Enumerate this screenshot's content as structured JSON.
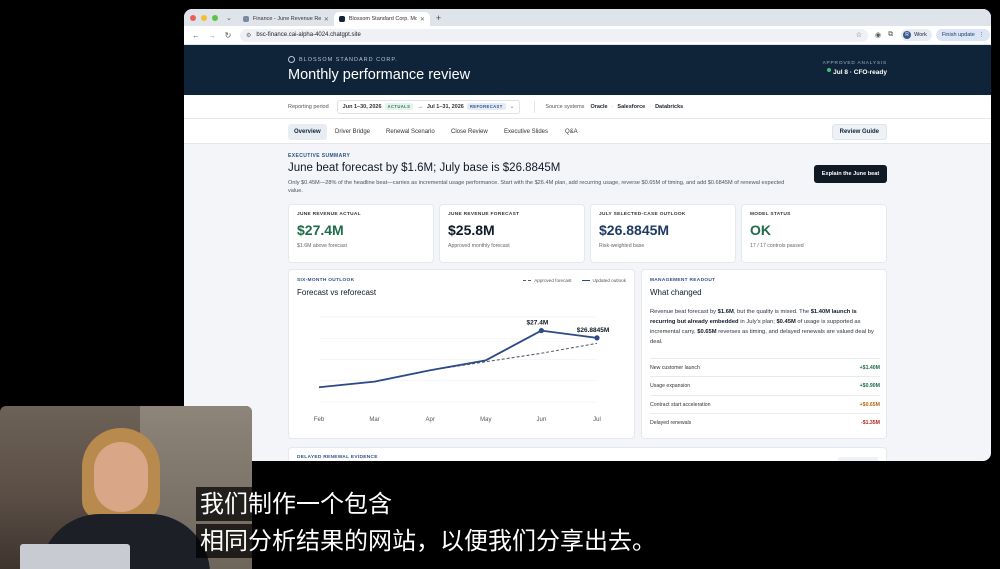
{
  "browser": {
    "tabs": [
      {
        "title": "Finance - June Revenue Rec",
        "active": false
      },
      {
        "title": "Blossom Standard Corp. Mo",
        "active": true
      }
    ],
    "url": "bsc-finance.cai-alpha-4024.chatgpt.site",
    "profile_label": "Work",
    "profile_initial": "R",
    "update_label": "Finish update"
  },
  "header": {
    "brand": "BLOSSOM STANDARD CORP.",
    "title": "Monthly performance review",
    "status_label": "APPROVED ANALYSIS",
    "status_value": "Jul 8 · CFO-ready"
  },
  "period": {
    "label": "Reporting period",
    "from": "Jun 1–30, 2026",
    "from_tag": "ACTUALS",
    "to": "Jul 1–31, 2026",
    "to_tag": "REFORECAST",
    "sources_label": "Source systems",
    "sources": [
      "Oracle",
      "Salesforce",
      "Databricks"
    ]
  },
  "nav": {
    "tabs": [
      "Overview",
      "Driver Bridge",
      "Renewal Scenario",
      "Close Review",
      "Executive Slides",
      "Q&A"
    ],
    "active": "Overview",
    "guide": "Review Guide"
  },
  "summary": {
    "kicker": "EXECUTIVE SUMMARY",
    "title": "June beat forecast by $1.6M; July base is $26.8845M",
    "body": "Only $0.45M—28% of the headline beat—carries as incremental usage performance. Start with the $26.4M plan, add recurring usage, reverse $0.65M of timing, and add $0.6845M of renewal expected value.",
    "button": "Explain the June beat"
  },
  "kpis": [
    {
      "label": "JUNE REVENUE ACTUAL",
      "value": "$27.4M",
      "sub": "$1.6M above forecast",
      "color": "#1f6b4a"
    },
    {
      "label": "JUNE REVENUE FORECAST",
      "value": "$25.8M",
      "sub": "Approved monthly forecast",
      "color": "#0f1a26"
    },
    {
      "label": "JULY SELECTED-CASE OUTLOOK",
      "value": "$26.8845M",
      "sub": "Risk-weighted base",
      "color": "#1f3b66"
    },
    {
      "label": "MODEL STATUS",
      "value": "OK",
      "sub": "17 / 17 controls passed",
      "color": "#1f6b4a"
    }
  ],
  "chart": {
    "kicker": "SIX-MONTH OUTLOOK",
    "title": "Forecast vs reforecast",
    "legend_approved": "Approved forecast",
    "legend_updated": "Updated outlook"
  },
  "chart_data": {
    "type": "line",
    "x": [
      "Feb",
      "Mar",
      "Apr",
      "May",
      "Jun",
      "Jul"
    ],
    "series": [
      {
        "name": "Approved forecast",
        "values": [
          23.4,
          23.8,
          24.6,
          25.2,
          25.8,
          26.5
        ],
        "style": "dashed",
        "color": "#55606e"
      },
      {
        "name": "Updated outlook",
        "values": [
          23.4,
          23.8,
          24.6,
          25.3,
          27.4,
          26.8845
        ],
        "style": "solid",
        "color": "#2b4a86"
      }
    ],
    "point_labels": [
      {
        "index": 4,
        "series": 1,
        "text": "$27.4M"
      },
      {
        "index": 5,
        "series": 1,
        "text": "$26.8845M"
      }
    ],
    "ylim": [
      22.5,
      28.5
    ],
    "grid": true
  },
  "readout": {
    "kicker": "MANAGEMENT READOUT",
    "title": "What changed",
    "body_parts": [
      {
        "t": "Revenue beat forecast by ",
        "b": false
      },
      {
        "t": "$1.6M",
        "b": true
      },
      {
        "t": ", but the quality is mixed. The ",
        "b": false
      },
      {
        "t": "$1.40M launch is recurring but already embedded",
        "b": true
      },
      {
        "t": " in July's plan; ",
        "b": false
      },
      {
        "t": "$0.45M",
        "b": true
      },
      {
        "t": " of usage is supported as incremental carry, ",
        "b": false
      },
      {
        "t": "$0.65M",
        "b": true
      },
      {
        "t": " reverses as timing, and delayed renewals are valued deal by deal.",
        "b": false
      }
    ],
    "drivers": [
      {
        "label": "New customer launch",
        "value": "+$1.40M",
        "color": "#1f6b4a"
      },
      {
        "label": "Usage expansion",
        "value": "+$0.90M",
        "color": "#1f6b4a"
      },
      {
        "label": "Contract start acceleration",
        "value": "+$0.65M",
        "color": "#b06a12"
      },
      {
        "label": "Delayed renewals",
        "value": "-$1.35M",
        "color": "#b3261e"
      }
    ]
  },
  "evidence": {
    "kicker": "DELAYED RENEWAL EVIDENCE"
  },
  "subtitles": {
    "line1": "我们制作一个包含",
    "line2": "相同分析结果的网站，以便我们分享出去。"
  }
}
